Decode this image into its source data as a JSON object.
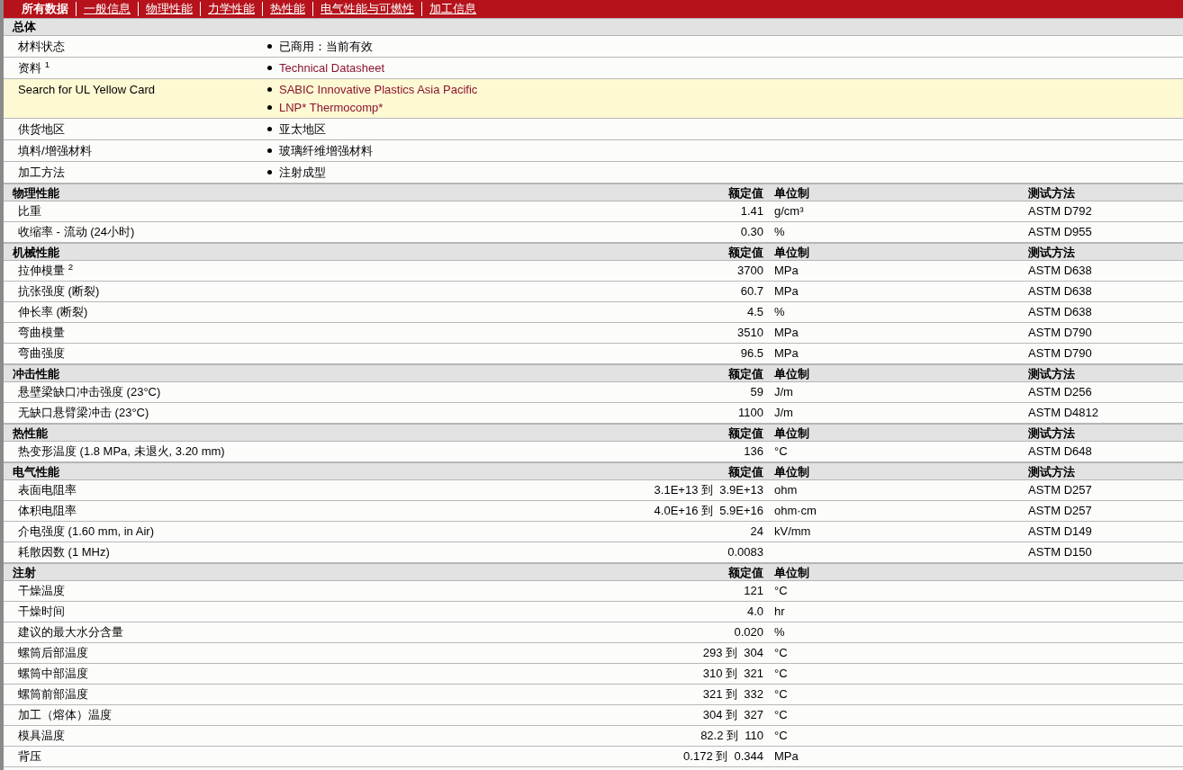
{
  "nav": [
    {
      "label": "所有数据",
      "selected": true
    },
    {
      "label": "一般信息",
      "selected": false
    },
    {
      "label": "物理性能",
      "selected": false
    },
    {
      "label": "力学性能",
      "selected": false
    },
    {
      "label": "热性能",
      "selected": false
    },
    {
      "label": "电气性能与可燃性",
      "selected": false
    },
    {
      "label": "加工信息",
      "selected": false
    }
  ],
  "sections": [
    {
      "title": "总体",
      "kind": "general",
      "rows": [
        {
          "label": "材料状态",
          "highlighted": false,
          "items": [
            {
              "text": "已商用：当前有效",
              "link": false
            }
          ]
        },
        {
          "label": "资料 $^{1}$",
          "highlighted": false,
          "items": [
            {
              "text": "Technical Datasheet",
              "link": true
            }
          ]
        },
        {
          "label": "Search for UL Yellow Card",
          "highlighted": true,
          "items": [
            {
              "text": "SABIC Innovative Plastics Asia Pacific",
              "link": true
            },
            {
              "text": "LNP* Thermocomp*",
              "link": true
            }
          ]
        },
        {
          "label": "供货地区",
          "highlighted": false,
          "items": [
            {
              "text": "亚太地区",
              "link": false
            }
          ]
        },
        {
          "label": "填料/增强材料",
          "highlighted": false,
          "items": [
            {
              "text": "玻璃纤维增强材料",
              "link": false
            }
          ]
        },
        {
          "label": "加工方法",
          "highlighted": false,
          "items": [
            {
              "text": "注射成型",
              "link": false
            }
          ]
        }
      ]
    },
    {
      "title": "物理性能",
      "kind": "property",
      "headers": {
        "value": "额定值",
        "unit": "单位制",
        "method": "测试方法"
      },
      "rows": [
        {
          "label": "比重",
          "value": "1.41",
          "unit": "g/cm³",
          "method": "ASTM D792"
        },
        {
          "label": "收缩率  - 流动  (24小时)",
          "value": "0.30",
          "unit": "%",
          "method": "ASTM D955"
        }
      ]
    },
    {
      "title": "机械性能",
      "kind": "property",
      "headers": {
        "value": "额定值",
        "unit": "单位制",
        "method": "测试方法"
      },
      "rows": [
        {
          "label": "拉伸模量 $^{2}$",
          "value": "3700",
          "unit": "MPa",
          "method": "ASTM D638"
        },
        {
          "label": "抗张强度  (断裂)",
          "value": "60.7",
          "unit": "MPa",
          "method": "ASTM D638"
        },
        {
          "label": "伸长率  (断裂)",
          "value": "4.5",
          "unit": "%",
          "method": "ASTM D638"
        },
        {
          "label": "弯曲模量",
          "value": "3510",
          "unit": "MPa",
          "method": "ASTM D790"
        },
        {
          "label": "弯曲强度",
          "value": "96.5",
          "unit": "MPa",
          "method": "ASTM D790"
        }
      ]
    },
    {
      "title": "冲击性能",
      "kind": "property",
      "headers": {
        "value": "额定值",
        "unit": "单位制",
        "method": "测试方法"
      },
      "rows": [
        {
          "label": "悬壁梁缺口冲击强度  (23°C)",
          "value": "59",
          "unit": "J/m",
          "method": "ASTM D256"
        },
        {
          "label": "无缺口悬臂梁冲击  (23°C)",
          "value": "1100",
          "unit": "J/m",
          "method": "ASTM D4812"
        }
      ]
    },
    {
      "title": "热性能",
      "kind": "property",
      "headers": {
        "value": "额定值",
        "unit": "单位制",
        "method": "测试方法"
      },
      "rows": [
        {
          "label": "热变形温度  (1.8 MPa, 未退火, 3.20 mm)",
          "value": "136",
          "unit": "°C",
          "method": "ASTM D648"
        }
      ]
    },
    {
      "title": "电气性能",
      "kind": "property",
      "headers": {
        "value": "额定值",
        "unit": "单位制",
        "method": "测试方法"
      },
      "rows": [
        {
          "label": "表面电阻率",
          "value": "3.1E+13 到  3.9E+13",
          "unit": "ohm",
          "method": "ASTM D257"
        },
        {
          "label": "体积电阻率",
          "value": "4.0E+16 到  5.9E+16",
          "unit": "ohm·cm",
          "method": "ASTM D257"
        },
        {
          "label": "介电强度  (1.60 mm, in Air)",
          "value": "24",
          "unit": "kV/mm",
          "method": "ASTM D149"
        },
        {
          "label": "耗散因数  (1 MHz)",
          "value": "0.0083",
          "method": "ASTM D150"
        }
      ]
    },
    {
      "title": "注射",
      "kind": "property",
      "headers": {
        "value": "额定值",
        "unit": "单位制"
      },
      "rows": [
        {
          "label": "干燥温度",
          "value": "121",
          "unit": "°C"
        },
        {
          "label": "干燥时间",
          "value": "4.0",
          "unit": "hr"
        },
        {
          "label": "建议的最大水分含量",
          "value": "0.020",
          "unit": "%"
        },
        {
          "label": "螺筒后部温度",
          "value": "293 到  304",
          "unit": "°C"
        },
        {
          "label": "螺筒中部温度",
          "value": "310 到  321",
          "unit": "°C"
        },
        {
          "label": "螺筒前部温度",
          "value": "321 到  332",
          "unit": "°C"
        },
        {
          "label": "加工（熔体）温度",
          "value": "304 到  327",
          "unit": "°C"
        },
        {
          "label": "模具温度",
          "value": "82.2 到  110",
          "unit": "°C"
        },
        {
          "label": "背压",
          "value": "0.172 到  0.344",
          "unit": "MPa"
        }
      ]
    }
  ]
}
